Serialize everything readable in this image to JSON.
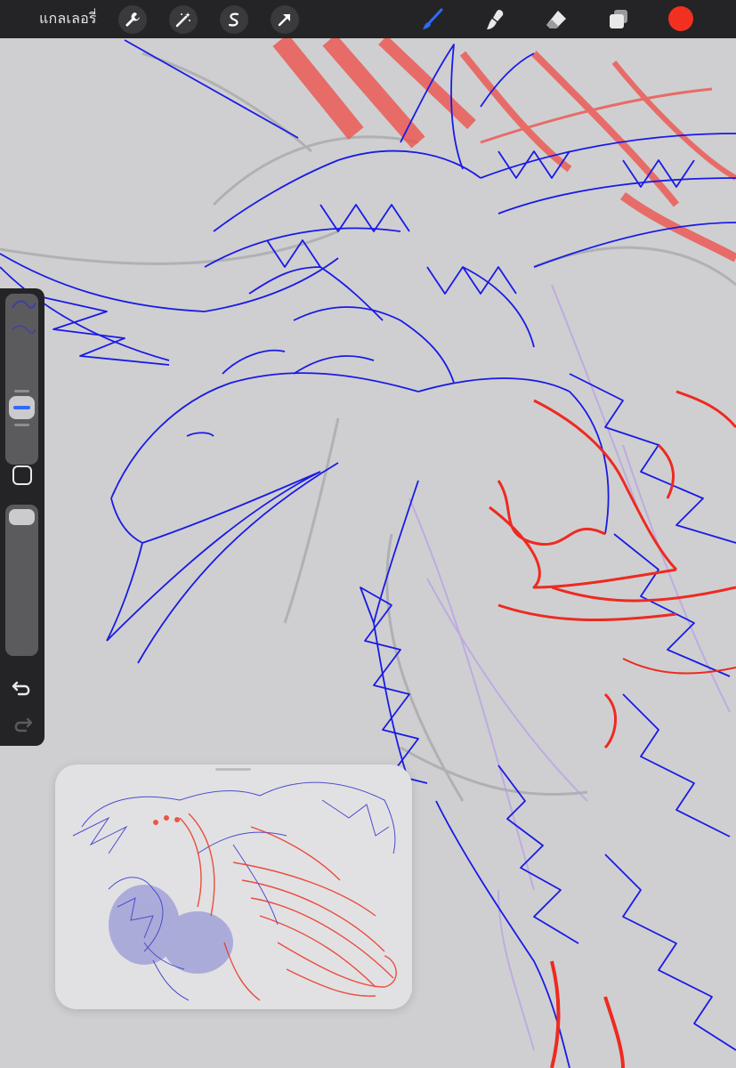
{
  "toolbar": {
    "gallery_label": "แกลเลอรี่",
    "left_tools": [
      "wrench-icon",
      "magic-wand-icon",
      "selection-s-icon",
      "arrow-transform-icon"
    ],
    "right_tools": [
      "brush-icon",
      "smudge-icon",
      "eraser-icon",
      "layers-icon"
    ],
    "active_tool": "brush",
    "current_color": "#f2301f"
  },
  "sidebar": {
    "controls": [
      "brush-size-slider",
      "modify-button",
      "opacity-slider",
      "undo-icon",
      "redo-icon"
    ]
  },
  "colors": {
    "line_blue": "#1a1ae6",
    "line_red": "#ee2a20",
    "accent_blue": "#2f6bf5",
    "canvas_bg": "#cfcfd1"
  }
}
